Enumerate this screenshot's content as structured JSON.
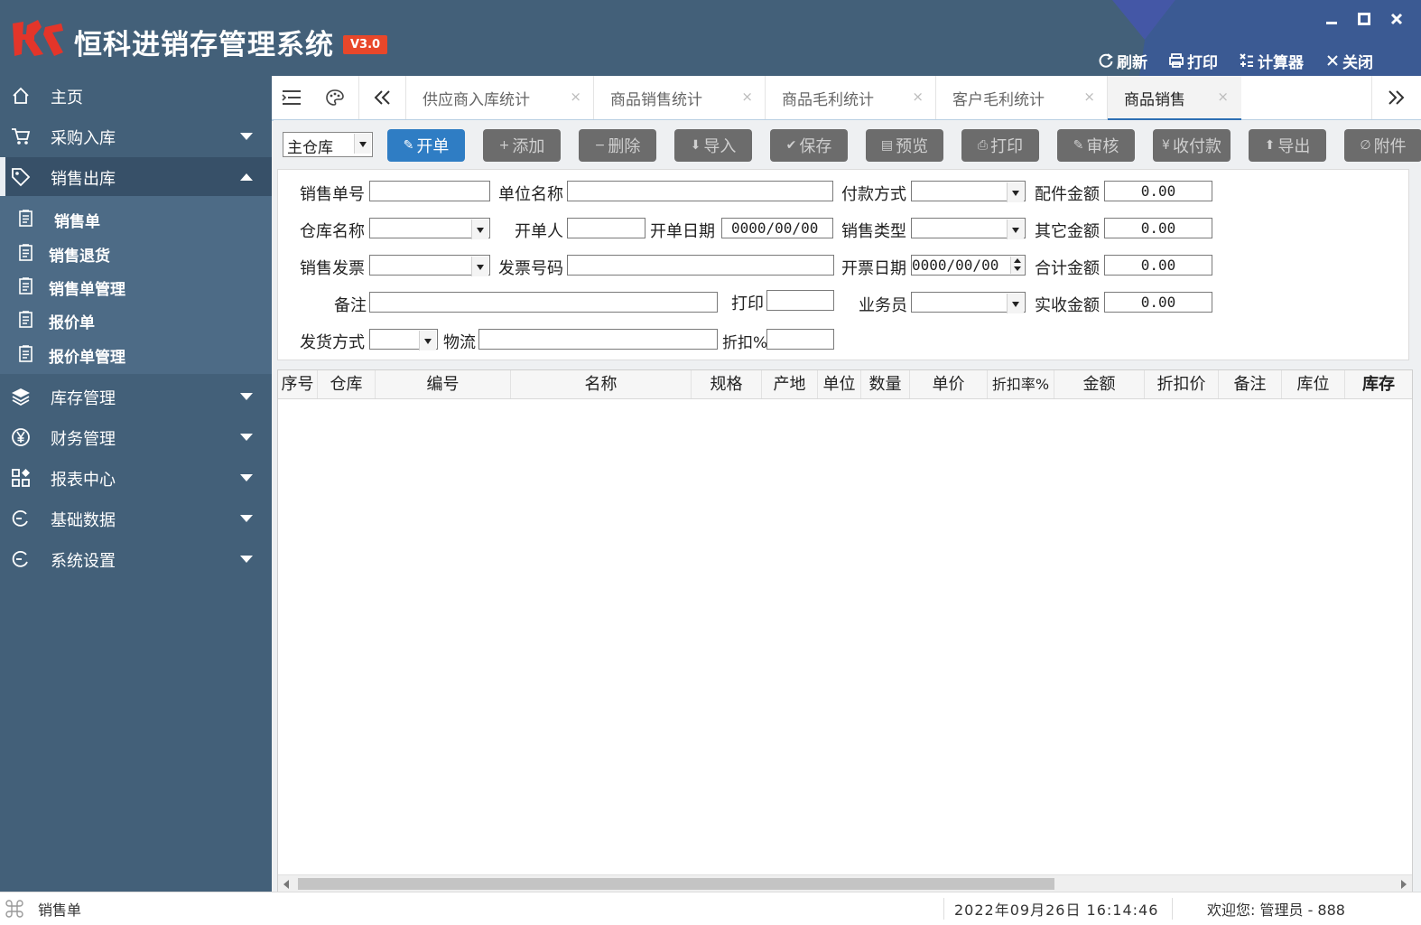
{
  "app": {
    "title": "恒科进销存管理系统",
    "version": "V3.0",
    "logo_text": "HK"
  },
  "toolbar": {
    "refresh": "刷新",
    "print": "打印",
    "calculator": "计算器",
    "close": "关闭"
  },
  "sidebar": {
    "items": [
      {
        "label": "主页",
        "icon": "home-icon"
      },
      {
        "label": "采购入库",
        "icon": "cart-icon"
      },
      {
        "label": "销售出库",
        "icon": "tag-icon"
      },
      {
        "label": "库存管理",
        "icon": "layers-icon"
      },
      {
        "label": "财务管理",
        "icon": "yen-icon"
      },
      {
        "label": "报表中心",
        "icon": "dashboard-icon"
      },
      {
        "label": "基础数据",
        "icon": "refresh-circle-icon"
      },
      {
        "label": "系统设置",
        "icon": "refresh-circle-icon"
      }
    ],
    "submenu": [
      {
        "label": "销售单"
      },
      {
        "label": "销售退货"
      },
      {
        "label": "销售单管理"
      },
      {
        "label": "报价单"
      },
      {
        "label": "报价单管理"
      }
    ]
  },
  "tabs": [
    {
      "label": "供应商入库统计",
      "close": "×"
    },
    {
      "label": "商品销售统计",
      "close": "×"
    },
    {
      "label": "商品毛利统计",
      "close": "×"
    },
    {
      "label": "客户毛利统计",
      "close": "×"
    },
    {
      "label": "商品销售",
      "close": "×",
      "active": true
    }
  ],
  "actions": {
    "warehouse": "主仓库",
    "buttons": [
      {
        "label": "开单",
        "icon": "edit-icon",
        "glyph": "✎"
      },
      {
        "label": "添加",
        "icon": "plus-icon",
        "glyph": "+"
      },
      {
        "label": "删除",
        "icon": "minus-icon",
        "glyph": "−"
      },
      {
        "label": "导入",
        "icon": "arrow-down-icon",
        "glyph": "⬇"
      },
      {
        "label": "保存",
        "icon": "check-icon",
        "glyph": "✔"
      },
      {
        "label": "预览",
        "icon": "preview-icon",
        "glyph": "▤"
      },
      {
        "label": "打印",
        "icon": "printer-icon",
        "glyph": "⎙"
      },
      {
        "label": "审核",
        "icon": "edit-icon",
        "glyph": "✎"
      },
      {
        "label": "收付款",
        "icon": "yen-icon",
        "glyph": "¥"
      },
      {
        "label": "导出",
        "icon": "arrow-up-icon",
        "glyph": "⬆"
      },
      {
        "label": "附件",
        "icon": "paperclip-icon",
        "glyph": "∅"
      }
    ]
  },
  "form": {
    "sale_no": {
      "label": "销售单号",
      "value": ""
    },
    "unit_name": {
      "label": "单位名称",
      "value": ""
    },
    "payment_method": {
      "label": "付款方式",
      "value": ""
    },
    "parts_amount": {
      "label": "配件金额",
      "value": "0.00"
    },
    "warehouse_name": {
      "label": "仓库名称",
      "value": ""
    },
    "issuer": {
      "label": "开单人",
      "value": ""
    },
    "issue_date": {
      "label": "开单日期",
      "value": "0000/00/00"
    },
    "sale_type": {
      "label": "销售类型",
      "value": ""
    },
    "other_amount": {
      "label": "其它金额",
      "value": "0.00"
    },
    "sales_invoice": {
      "label": "销售发票",
      "value": ""
    },
    "invoice_no": {
      "label": "发票号码",
      "value": ""
    },
    "invoice_date": {
      "label": "开票日期",
      "value": "0000/00/00"
    },
    "total_amount": {
      "label": "合计金额",
      "value": "0.00"
    },
    "remark": {
      "label": "备注",
      "value": ""
    },
    "printed": {
      "label": "打印",
      "value": ""
    },
    "salesman": {
      "label": "业务员",
      "value": ""
    },
    "received_amount": {
      "label": "实收金额",
      "value": "0.00"
    },
    "delivery_method": {
      "label": "发货方式",
      "value": ""
    },
    "logistics": {
      "label": "物流",
      "value": ""
    },
    "discount": {
      "label": "折扣%",
      "value": ""
    }
  },
  "grid": {
    "columns": [
      "序号",
      "仓库",
      "编号",
      "名称",
      "规格",
      "产地",
      "单位",
      "数量",
      "单价",
      "折扣率%",
      "金额",
      "折扣价",
      "备注",
      "库位",
      "库存"
    ],
    "rows": []
  },
  "status": {
    "current": "销售单",
    "datetime": "2022年09月26日 16:14:46",
    "welcome": "欢迎您: 管理员 - 888"
  },
  "colors": {
    "sidebar": "#436079",
    "submenu": "#4d6b86",
    "primary": "#2f7dc4",
    "disabled_button": "#6c6c6c",
    "version_badge": "#e8472a"
  }
}
